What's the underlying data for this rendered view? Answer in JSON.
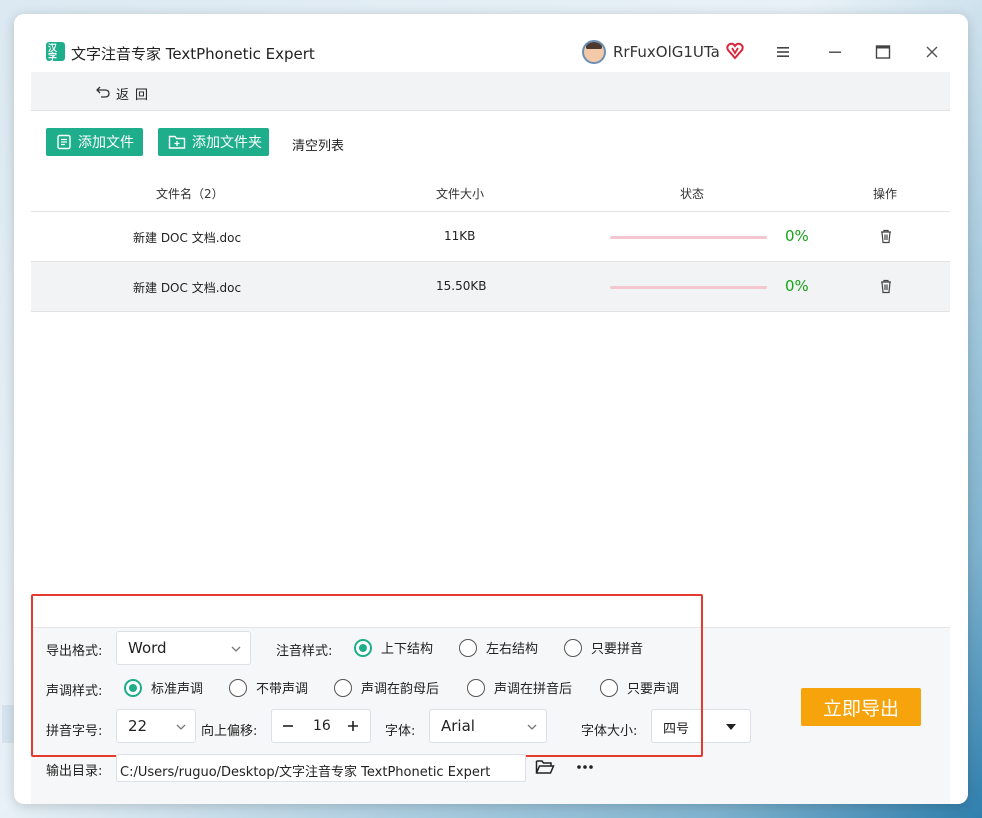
{
  "window": {
    "title": "文字注音专家 TextPhonetic Expert",
    "logo_text": "汉字",
    "username": "RrFuxOlG1UTa"
  },
  "nav": {
    "back_label": "返回"
  },
  "toolbar": {
    "add_file": "添加文件",
    "add_folder": "添加文件夹",
    "clear_list": "清空列表"
  },
  "table": {
    "headers": [
      "文件名（2）",
      "文件大小",
      "状态",
      "操作"
    ],
    "rows": [
      {
        "name": "新建 DOC 文档.doc",
        "size": "11KB",
        "progress": 0,
        "status": "0%"
      },
      {
        "name": "新建 DOC 文档.doc",
        "size": "15.50KB",
        "progress": 0,
        "status": "0%"
      }
    ]
  },
  "settings": {
    "export_format_label": "导出格式:",
    "export_format_value": "Word",
    "phonetic_style_label": "注音样式:",
    "phonetic_style_options": [
      "上下结构",
      "左右结构",
      "只要拼音"
    ],
    "phonetic_style_selected": "上下结构",
    "tone_style_label": "声调样式:",
    "tone_style_options": [
      "标准声调",
      "不带声调",
      "声调在韵母后",
      "声调在拼音后",
      "只要声调"
    ],
    "tone_style_selected": "标准声调",
    "pinyin_size_label": "拼音字号:",
    "pinyin_size_value": "22",
    "offset_label": "向上偏移:",
    "offset_value": "16",
    "font_label": "字体:",
    "font_value": "Arial",
    "font_size_label": "字体大小:",
    "font_size_value": "四号",
    "output_dir_label": "输出目录:",
    "output_dir_value": "C:/Users/ruguo/Desktop/文字注音专家 TextPhonetic Expert",
    "export_button": "立即导出"
  },
  "colors": {
    "accent": "#1eae8c",
    "export": "#f6a30c",
    "highlight_box": "#e53a2e",
    "status_text": "#16a316",
    "progress_track": "#f3c6d0"
  }
}
